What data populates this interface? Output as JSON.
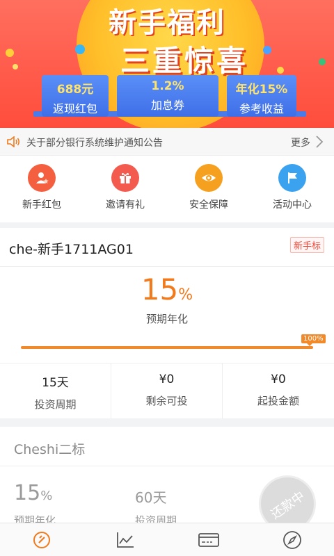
{
  "banner": {
    "title_line1": "新手福利",
    "title_line2": "三重惊喜",
    "tiles": [
      {
        "value": "688元",
        "label": "返现红包"
      },
      {
        "value": "1.2%",
        "label": "加息券"
      },
      {
        "value": "年化15%",
        "label": "参考收益"
      }
    ]
  },
  "notice": {
    "text": "关于部分银行系统维护通知公告",
    "more": "更多"
  },
  "quick": [
    {
      "label": "新手红包",
      "icon": "user-star-icon",
      "color": "#f4603f"
    },
    {
      "label": "邀请有礼",
      "icon": "gift-icon",
      "color": "#f35b4e"
    },
    {
      "label": "安全保障",
      "icon": "eye-shield-icon",
      "color": "#f5a01f"
    },
    {
      "label": "活动中心",
      "icon": "flag-icon",
      "color": "#3aa2ee"
    }
  ],
  "product1": {
    "name": "che-新手1711AG01",
    "badge": "新手标",
    "rate_num": "15",
    "rate_pct": "%",
    "rate_label": "预期年化",
    "progress": 100,
    "progress_label": "100%",
    "stats": [
      {
        "value": "15天",
        "label": "投资周期"
      },
      {
        "value": "¥0",
        "label": "剩余可投"
      },
      {
        "value": "¥0",
        "label": "起投金额"
      }
    ]
  },
  "product2": {
    "name": "Cheshi二标",
    "rate_num": "15",
    "rate_pct": "%",
    "rate_label": "预期年化",
    "duration": "60天",
    "duration_label": "投资周期",
    "stamp": "还款中"
  },
  "tabbar": {
    "tabs": [
      {
        "icon": "home-coin-icon",
        "active": true
      },
      {
        "icon": "chart-line-icon",
        "active": false
      },
      {
        "icon": "card-icon",
        "active": false
      },
      {
        "icon": "compass-icon",
        "active": false
      }
    ]
  },
  "colors": {
    "accent": "#f07a1c",
    "banner_red": "#ff5a4a",
    "tile_blue": "#4a7be8",
    "badge_red": "#ef4b3c"
  }
}
